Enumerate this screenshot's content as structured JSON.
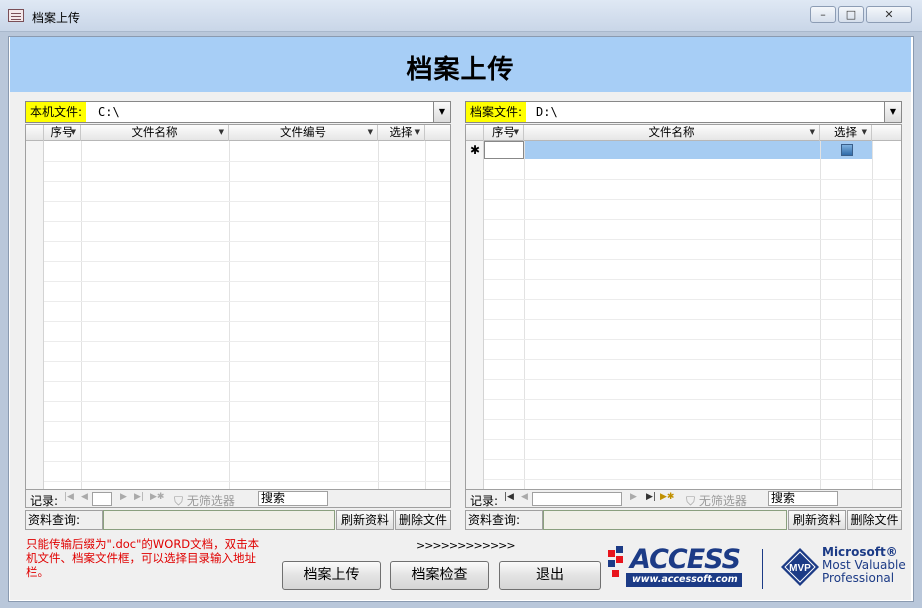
{
  "window": {
    "title": "档案上传",
    "controls": [
      "–",
      "□",
      "✕"
    ]
  },
  "header": {
    "title": "档案上传"
  },
  "left_panel": {
    "combo_label": "本机文件:",
    "combo_value": "C:\\",
    "columns": [
      "序号",
      "文件名称",
      "文件编号",
      "选择"
    ],
    "nav": {
      "record_label": "记录:",
      "filter_label": "无筛选器",
      "search_value": "搜索"
    },
    "query_label": "资料查询:",
    "buttons": {
      "refresh": "刷新资料",
      "delete": "删除文件"
    }
  },
  "right_panel": {
    "combo_label": "档案文件:",
    "combo_value": "D:\\",
    "columns": [
      "序号",
      "文件名称",
      "选择"
    ],
    "new_row_marker": "✱",
    "nav": {
      "record_label": "记录:",
      "filter_label": "无筛选器",
      "search_value": "搜索"
    },
    "query_label": "资料查询:",
    "buttons": {
      "refresh": "刷新资料",
      "delete": "删除文件"
    }
  },
  "footer": {
    "note": "只能传输后缀为\".doc\"的WORD文档，双击本机文件、档案文件框，可以选择目录输入地址栏。",
    "arrows": ">>>>>>>>>>>>",
    "buttons": {
      "upload": "档案上传",
      "check": "档案检查",
      "exit": "退出"
    }
  },
  "logos": {
    "access_text": "ACCESS",
    "access_url": "www.accessoft.com",
    "mvp_badge": "MVP",
    "mvp_line1": "Microsoft®",
    "mvp_line2": "Most Valuable",
    "mvp_line3": "Professional"
  },
  "colors": {
    "header_bg": "#a7cef6",
    "label_highlight": "#ffff00",
    "note_text": "#e00000",
    "brand_blue": "#1c3b86"
  }
}
